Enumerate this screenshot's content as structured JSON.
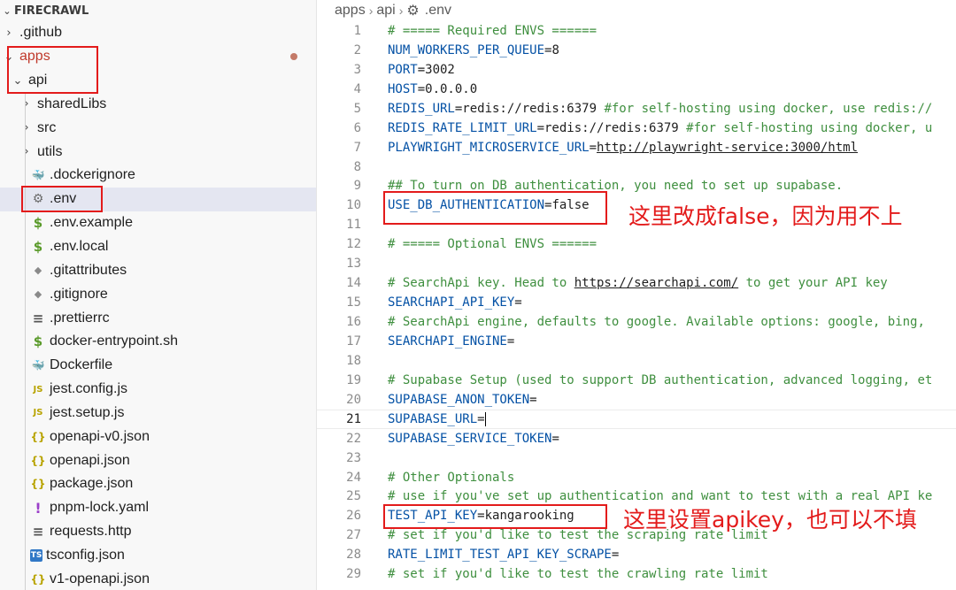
{
  "explorer": {
    "title": "FIRECRAWL",
    "items": [
      {
        "label": ".github",
        "arrow": "›",
        "icon": ""
      },
      {
        "label": "apps",
        "arrow": "⌄",
        "icon": ""
      },
      {
        "label": "api",
        "arrow": "⌄",
        "icon": ""
      },
      {
        "label": "sharedLibs",
        "arrow": "›",
        "icon": ""
      },
      {
        "label": "src",
        "arrow": "›",
        "icon": ""
      },
      {
        "label": "utils",
        "arrow": "›",
        "icon": ""
      },
      {
        "label": ".dockerignore",
        "arrow": "",
        "icon": "docker-icon"
      },
      {
        "label": ".env",
        "arrow": "",
        "icon": "gear-icon"
      },
      {
        "label": ".env.example",
        "arrow": "",
        "icon": "dollar-icon"
      },
      {
        "label": ".env.local",
        "arrow": "",
        "icon": "dollar-icon"
      },
      {
        "label": ".gitattributes",
        "arrow": "",
        "icon": "git-icon"
      },
      {
        "label": ".gitignore",
        "arrow": "",
        "icon": "git-icon"
      },
      {
        "label": ".prettierrc",
        "arrow": "",
        "icon": "lines-icon"
      },
      {
        "label": "docker-entrypoint.sh",
        "arrow": "",
        "icon": "dollar-icon"
      },
      {
        "label": "Dockerfile",
        "arrow": "",
        "icon": "docker-icon"
      },
      {
        "label": "jest.config.js",
        "arrow": "",
        "icon": "js-icon"
      },
      {
        "label": "jest.setup.js",
        "arrow": "",
        "icon": "js-icon"
      },
      {
        "label": "openapi-v0.json",
        "arrow": "",
        "icon": "braces-icon"
      },
      {
        "label": "openapi.json",
        "arrow": "",
        "icon": "braces-icon"
      },
      {
        "label": "package.json",
        "arrow": "",
        "icon": "braces-icon"
      },
      {
        "label": "pnpm-lock.yaml",
        "arrow": "",
        "icon": "exclamation-icon"
      },
      {
        "label": "requests.http",
        "arrow": "",
        "icon": "lines-icon"
      },
      {
        "label": "tsconfig.json",
        "arrow": "",
        "icon": "ts-icon"
      },
      {
        "label": "v1-openapi.json",
        "arrow": "",
        "icon": "braces-icon"
      }
    ]
  },
  "breadcrumb": {
    "part1": "apps",
    "part2": "api",
    "part3": ".env"
  },
  "code": [
    {
      "n": "1",
      "t": "# ===== Required ENVS ======"
    },
    {
      "n": "2",
      "t": "NUM_WORKERS_PER_QUEUE=8"
    },
    {
      "n": "3",
      "t": "PORT=3002"
    },
    {
      "n": "4",
      "t": "HOST=0.0.0.0"
    },
    {
      "n": "5",
      "t": "REDIS_URL=redis://redis:6379 #for self-hosting using docker, use redis://"
    },
    {
      "n": "6",
      "t": "REDIS_RATE_LIMIT_URL=redis://redis:6379 #for self-hosting using docker, u"
    },
    {
      "n": "7",
      "t": "PLAYWRIGHT_MICROSERVICE_URL=http://playwright-service:3000/html"
    },
    {
      "n": "8",
      "t": ""
    },
    {
      "n": "9",
      "t": "## To turn on DB authentication, you need to set up supabase."
    },
    {
      "n": "10",
      "t": "USE_DB_AUTHENTICATION=false"
    },
    {
      "n": "11",
      "t": ""
    },
    {
      "n": "12",
      "t": "# ===== Optional ENVS ======"
    },
    {
      "n": "13",
      "t": ""
    },
    {
      "n": "14",
      "t": "# SearchApi key. Head to https://searchapi.com/ to get your API key"
    },
    {
      "n": "15",
      "t": "SEARCHAPI_API_KEY="
    },
    {
      "n": "16",
      "t": "# SearchApi engine, defaults to google. Available options: google, bing,"
    },
    {
      "n": "17",
      "t": "SEARCHAPI_ENGINE="
    },
    {
      "n": "18",
      "t": ""
    },
    {
      "n": "19",
      "t": "# Supabase Setup (used to support DB authentication, advanced logging, et"
    },
    {
      "n": "20",
      "t": "SUPABASE_ANON_TOKEN="
    },
    {
      "n": "21",
      "t": "SUPABASE_URL="
    },
    {
      "n": "22",
      "t": "SUPABASE_SERVICE_TOKEN="
    },
    {
      "n": "23",
      "t": ""
    },
    {
      "n": "24",
      "t": "# Other Optionals"
    },
    {
      "n": "25",
      "t": "# use if you've set up authentication and want to test with a real API ke"
    },
    {
      "n": "26",
      "t": "TEST_API_KEY=kangarooking"
    },
    {
      "n": "27",
      "t": "# set if you'd like to test the scraping rate limit"
    },
    {
      "n": "28",
      "t": "RATE_LIMIT_TEST_API_KEY_SCRAPE="
    },
    {
      "n": "29",
      "t": "# set if you'd like to test the crawling rate limit"
    }
  ],
  "annotations": {
    "note1": "这里改成false，因为用不上",
    "note2": "这里设置apikey，也可以不填"
  },
  "colors": {
    "key": "#0451a5",
    "comment": "#3f8f3f",
    "annotation": "#e31b1b",
    "selected_row": "#e4e6f1"
  }
}
